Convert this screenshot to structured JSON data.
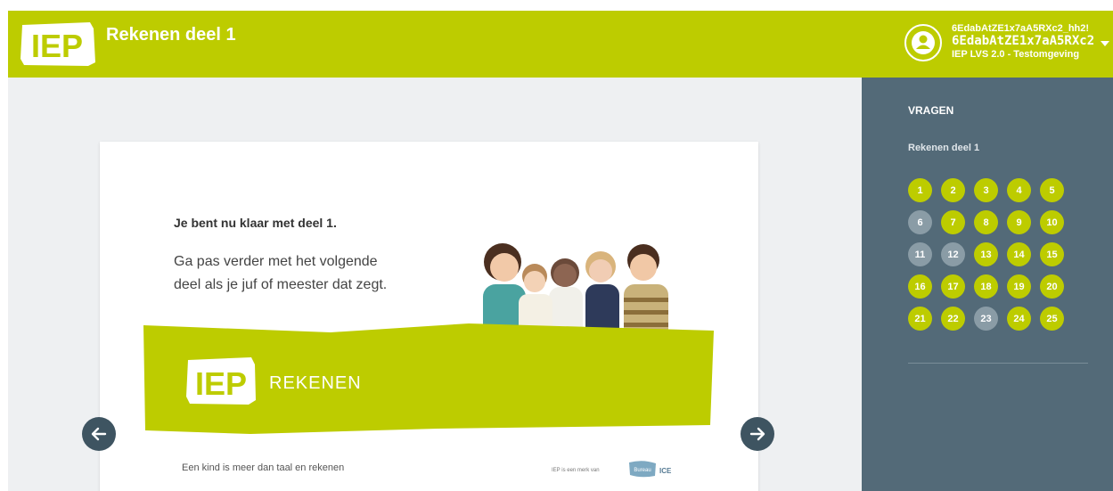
{
  "header": {
    "title": "Rekenen deel 1",
    "logo_text": "IEP",
    "user": {
      "line1": "6EdabAtZE1x7aA5RXc2_hh2!",
      "line2": "6EdabAtZE1x7aA5RXc2",
      "environment": "IEP LVS 2.0 - Testomgeving"
    }
  },
  "card": {
    "heading": "Je bent nu klaar met deel 1.",
    "text_line1": "Ga pas verder met het volgende",
    "text_line2": "deel als je juf of meester dat zegt.",
    "banner_logo": "IEP",
    "banner_label": "REKENEN",
    "footer_left": "Een kind is meer dan taal en rekenen",
    "footer_right": "IEP is een merk van",
    "footer_badge": "Bureau",
    "footer_ice": "ICE"
  },
  "sidebar": {
    "title": "VRAGEN",
    "section": "Rekenen deel 1",
    "questions": [
      {
        "n": "1",
        "state": "done"
      },
      {
        "n": "2",
        "state": "done"
      },
      {
        "n": "3",
        "state": "done"
      },
      {
        "n": "4",
        "state": "done"
      },
      {
        "n": "5",
        "state": "done"
      },
      {
        "n": "6",
        "state": "todo"
      },
      {
        "n": "7",
        "state": "done"
      },
      {
        "n": "8",
        "state": "done"
      },
      {
        "n": "9",
        "state": "done"
      },
      {
        "n": "10",
        "state": "done"
      },
      {
        "n": "11",
        "state": "todo"
      },
      {
        "n": "12",
        "state": "todo"
      },
      {
        "n": "13",
        "state": "done"
      },
      {
        "n": "14",
        "state": "done"
      },
      {
        "n": "15",
        "state": "done"
      },
      {
        "n": "16",
        "state": "done"
      },
      {
        "n": "17",
        "state": "done"
      },
      {
        "n": "18",
        "state": "done"
      },
      {
        "n": "19",
        "state": "done"
      },
      {
        "n": "20",
        "state": "done"
      },
      {
        "n": "21",
        "state": "done"
      },
      {
        "n": "22",
        "state": "done"
      },
      {
        "n": "23",
        "state": "todo"
      },
      {
        "n": "24",
        "state": "done"
      },
      {
        "n": "25",
        "state": "done"
      }
    ]
  },
  "colors": {
    "accent": "#bdcc00",
    "sidebar_bg": "#536a78",
    "question_unanswered": "#8a9ca6",
    "nav_button": "#3e5461"
  },
  "icons": {
    "prev": "arrow-left-icon",
    "next": "arrow-right-icon",
    "user": "user-icon",
    "menu": "caret-down-icon"
  }
}
